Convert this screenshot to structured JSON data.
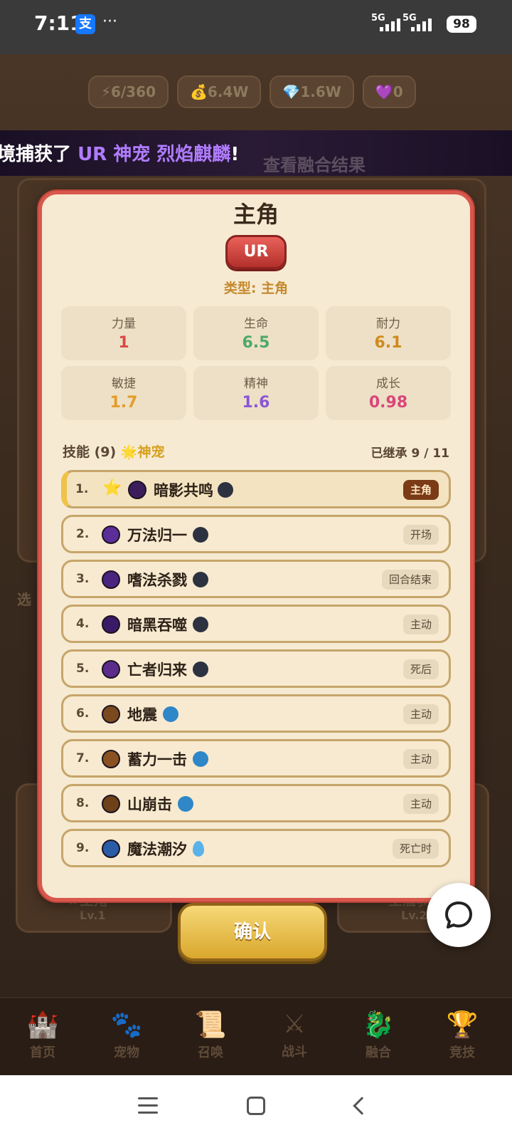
{
  "status_bar": {
    "time": "7:11",
    "app_icon_glyph": "支",
    "dots": "···",
    "signal1": "5G",
    "signal2": "5G",
    "battery": "98"
  },
  "resources": [
    "⚡6/360",
    "💰6.4W",
    "💎1.6W",
    "💜0"
  ],
  "banner": {
    "prefix": "境捕获了 ",
    "highlight": "UR 神宠 烈焰麒麟",
    "suffix": "!",
    "sub": "查看融合结果"
  },
  "background": {
    "card_label_1": "★主角",
    "card_level_1": "Lv.1",
    "card_label_3": "圣盾骑",
    "card_level_3": "Lv.2",
    "side_text": "选"
  },
  "modal": {
    "title": "主角",
    "rarity": "UR",
    "type": "类型: 主角",
    "stats": [
      {
        "label": "力量",
        "value": "1",
        "color": "#d94a45"
      },
      {
        "label": "生命",
        "value": "6.5",
        "color": "#4fa86a"
      },
      {
        "label": "耐力",
        "value": "6.1",
        "color": "#d08a1f"
      },
      {
        "label": "敏捷",
        "value": "1.7",
        "color": "#e39d2a"
      },
      {
        "label": "精神",
        "value": "1.6",
        "color": "#8b55d6"
      },
      {
        "label": "成长",
        "value": "0.98",
        "color": "#d9467a"
      }
    ],
    "skills_title": "技能 (9)",
    "skills_badge": "🌟神宠",
    "inherited": "已继承 9 / 11",
    "skills": [
      {
        "num": "1.",
        "name": "暗影共鸣",
        "tag": "主角",
        "icon_color": "#3b1d5c",
        "elem_color": "#2c3240"
      },
      {
        "num": "2.",
        "name": "万法归一",
        "tag": "开场",
        "icon_color": "#5a2f9a",
        "elem_color": "#2c3240"
      },
      {
        "num": "3.",
        "name": "嗜法杀戮",
        "tag": "回合结束",
        "icon_color": "#4a2580",
        "elem_color": "#2c3240"
      },
      {
        "num": "4.",
        "name": "暗黑吞噬",
        "tag": "主动",
        "icon_color": "#3a1a66",
        "elem_color": "#2c3240"
      },
      {
        "num": "5.",
        "name": "亡者归来",
        "tag": "死后",
        "icon_color": "#5b2c8c",
        "elem_color": "#2c3240"
      },
      {
        "num": "6.",
        "name": "地震",
        "tag": "主动",
        "icon_color": "#7a4a1e",
        "elem_color": "#2f86c8"
      },
      {
        "num": "7.",
        "name": "蓄力一击",
        "tag": "主动",
        "icon_color": "#8a5220",
        "elem_color": "#2f86c8"
      },
      {
        "num": "8.",
        "name": "山崩击",
        "tag": "主动",
        "icon_color": "#6e4118",
        "elem_color": "#2f86c8"
      },
      {
        "num": "9.",
        "name": "魔法潮汐",
        "tag": "死亡时",
        "icon_color": "#2a5ca8",
        "elem_color": "#5ab2ea"
      }
    ],
    "confirm": "确认"
  },
  "bottom_nav": [
    {
      "label": "首页",
      "icon": "castle-icon"
    },
    {
      "label": "宠物",
      "icon": "paw-icon"
    },
    {
      "label": "召唤",
      "icon": "scroll-icon"
    },
    {
      "label": "战斗",
      "icon": "swords-icon"
    },
    {
      "label": "融合",
      "icon": "dragon-icon"
    },
    {
      "label": "竞技",
      "icon": "trophy-icon"
    }
  ]
}
